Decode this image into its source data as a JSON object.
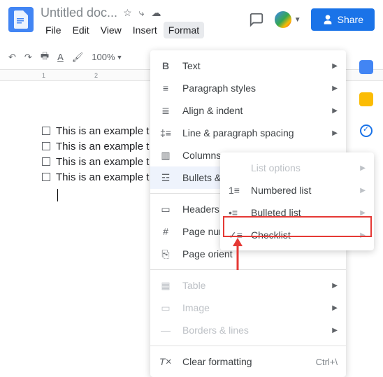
{
  "header": {
    "title": "Untitled doc...",
    "share_label": "Share"
  },
  "menubar": {
    "file": "File",
    "edit": "Edit",
    "view": "View",
    "insert": "Insert",
    "format": "Format"
  },
  "toolbar": {
    "zoom": "100%"
  },
  "ruler": {
    "t1": "1",
    "t2": "2"
  },
  "document": {
    "lines": [
      "This is an example t",
      "This is an example t",
      "This is an example t",
      "This is an example t"
    ]
  },
  "format_menu": {
    "text": "Text",
    "paragraph_styles": "Paragraph styles",
    "align_indent": "Align & indent",
    "line_spacing": "Line & paragraph spacing",
    "columns": "Columns",
    "bullets_numbering": "Bullets & nu",
    "headers_footers": "Headers & f",
    "page_numbers": "Page numb",
    "page_orientation": "Page orient",
    "table": "Table",
    "image": "Image",
    "borders_lines": "Borders & lines",
    "clear_formatting": "Clear formatting",
    "clear_shortcut": "Ctrl+\\"
  },
  "bullets_submenu": {
    "list_options": "List options",
    "numbered_list": "Numbered list",
    "bulleted_list": "Bulleted list",
    "checklist": "Checklist"
  }
}
